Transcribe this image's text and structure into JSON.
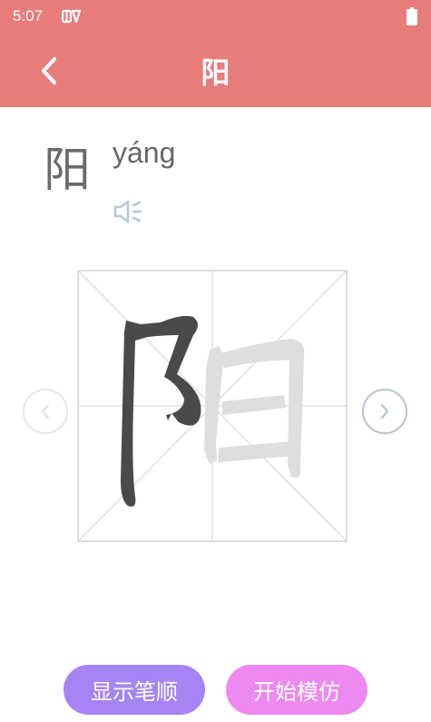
{
  "status_bar": {
    "time": "5:07"
  },
  "header": {
    "title": "阳"
  },
  "character": {
    "char": "阳",
    "pinyin": "yáng"
  },
  "actions": {
    "show_stroke_order": "显示笔顺",
    "start_imitate": "开始模仿"
  },
  "colors": {
    "header_bg": "#e77c7b",
    "button_show": "#a784f4",
    "button_imitate": "#ed89f0",
    "stroke_done": "#4a4a4a",
    "stroke_pending": "#dcdcdc"
  },
  "icons": [
    "app-notification-icon",
    "battery-icon",
    "back-arrow-icon",
    "speaker-icon",
    "chevron-left-icon",
    "chevron-right-icon"
  ]
}
